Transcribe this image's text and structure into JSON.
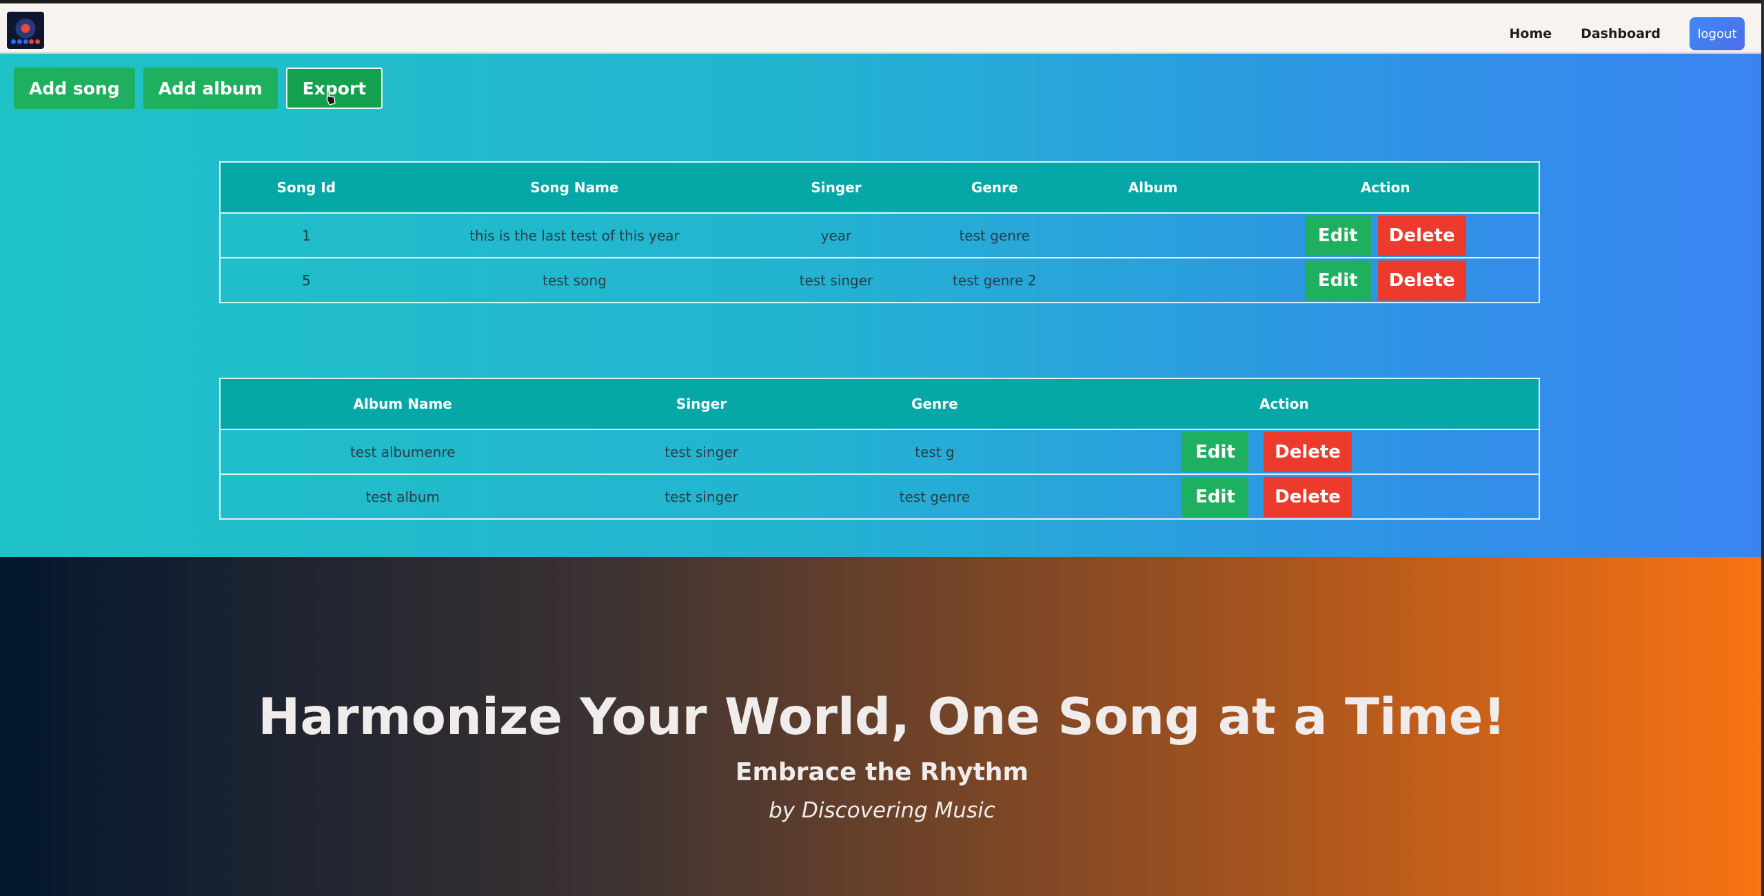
{
  "nav": {
    "home": "Home",
    "dashboard": "Dashboard",
    "logout": "logout"
  },
  "toolbar": {
    "add_song": "Add song",
    "add_album": "Add album",
    "export": "Export"
  },
  "songs_table": {
    "headers": [
      "Song Id",
      "Song Name",
      "Singer",
      "Genre",
      "Album",
      "Action"
    ],
    "rows": [
      {
        "id": "1",
        "name": "this is the last test of this year",
        "singer": "year",
        "genre": "test genre",
        "album": ""
      },
      {
        "id": "5",
        "name": "test song",
        "singer": "test singer",
        "genre": "test genre 2",
        "album": ""
      }
    ]
  },
  "albums_table": {
    "headers": [
      "Album Name",
      "Singer",
      "Genre",
      "Action"
    ],
    "rows": [
      {
        "name": "test albumenre",
        "singer": "test singer",
        "genre": "test g"
      },
      {
        "name": "test album",
        "singer": "test singer",
        "genre": "test genre"
      }
    ]
  },
  "actions": {
    "edit": "Edit",
    "delete": "Delete"
  },
  "hero": {
    "title": "Harmonize Your World, One Song at a Time!",
    "subtitle": "Embrace the Rhythm",
    "tagline": "by Discovering Music"
  },
  "colors": {
    "accent_green": "#1eb05e",
    "delete_red": "#ec3a2d",
    "table_header": "#05a8a6",
    "logout_blue": "#3d8af7"
  }
}
